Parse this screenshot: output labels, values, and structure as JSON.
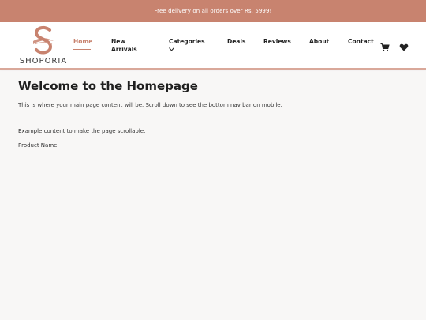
{
  "promo": {
    "text": "Free delivery on all orders over Rs. 5999!"
  },
  "brand": {
    "name": "SHOPORIA",
    "accent_color": "#c8836f"
  },
  "nav": {
    "items": [
      {
        "label": "Home",
        "active": true
      },
      {
        "label": "New Arrivals"
      },
      {
        "label": "Categories"
      },
      {
        "label": "Deals"
      },
      {
        "label": "Reviews"
      },
      {
        "label": "About"
      },
      {
        "label": "Contact"
      }
    ],
    "icons": [
      "cart-icon",
      "heart-icon",
      "chevron-down-icon"
    ]
  },
  "main": {
    "title": "Welcome to the Homepage",
    "intro": "This is where your main page content will be. Scroll down to see the bottom nav bar on mobile.",
    "example": "Example content to make the page scrollable.",
    "product": "Product Name"
  }
}
